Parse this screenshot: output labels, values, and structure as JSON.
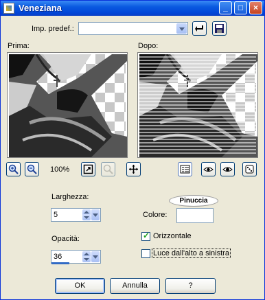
{
  "window": {
    "title": "Veneziana"
  },
  "titlebar": {
    "minimize": "_",
    "maximize": "□",
    "close": "×"
  },
  "preset": {
    "label": "Imp. predef.:",
    "value": ""
  },
  "preview": {
    "before_label": "Prima:",
    "after_label": "Dopo:"
  },
  "zoom": {
    "level": "100%"
  },
  "params": {
    "width_label": "Larghezza:",
    "width_value": "5",
    "opacity_label": "Opacità:",
    "opacity_value": "36",
    "opacity_fraction": 0.36,
    "color_label": "Colore:",
    "horizontal_label": "Orizzontale",
    "horizontal_checked": true,
    "light_label": "Luce dall'alto a sinistra",
    "light_checked": false
  },
  "watermark": {
    "text": "Pinuccia"
  },
  "buttons": {
    "ok": "OK",
    "cancel": "Annulla",
    "help": "?"
  },
  "colors": {
    "title_bar": "#0a5ae0",
    "dialog_bg": "#ece9d8",
    "accent": "#316ac5"
  }
}
